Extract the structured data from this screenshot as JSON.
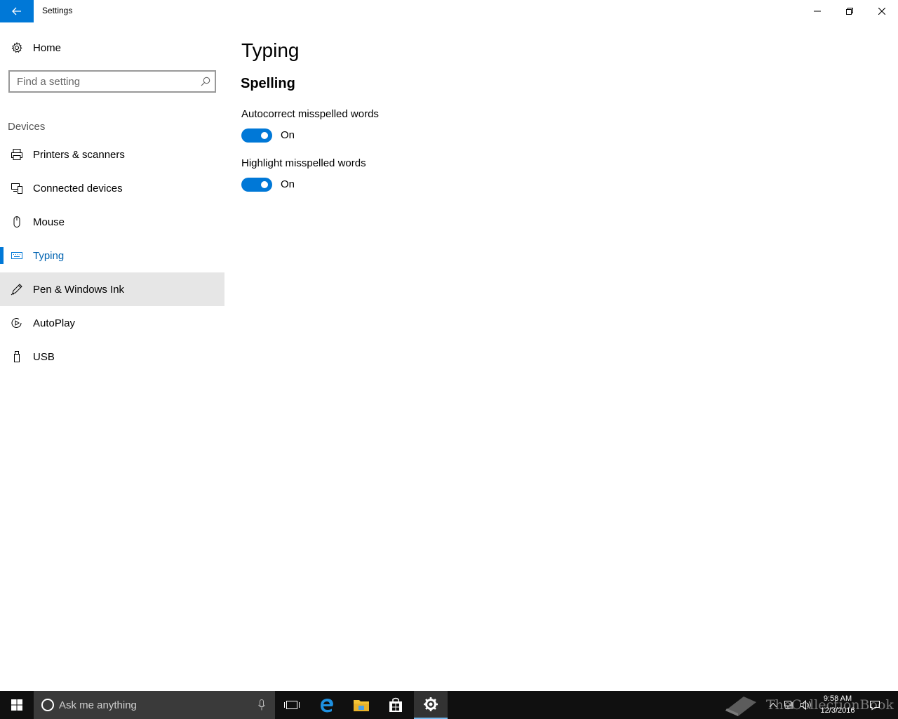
{
  "window": {
    "title": "Settings"
  },
  "sidebar": {
    "home_label": "Home",
    "search_placeholder": "Find a setting",
    "section": "Devices",
    "items": [
      {
        "label": "Printers & scanners",
        "icon": "printer-icon"
      },
      {
        "label": "Connected devices",
        "icon": "connected-devices-icon"
      },
      {
        "label": "Mouse",
        "icon": "mouse-icon"
      },
      {
        "label": "Typing",
        "icon": "keyboard-icon",
        "selected": true
      },
      {
        "label": "Pen & Windows Ink",
        "icon": "pen-icon",
        "hovered": true
      },
      {
        "label": "AutoPlay",
        "icon": "autoplay-icon"
      },
      {
        "label": "USB",
        "icon": "usb-icon"
      }
    ]
  },
  "main": {
    "title": "Typing",
    "section": "Spelling",
    "settings": [
      {
        "label": "Autocorrect misspelled words",
        "state": "On",
        "enabled": true
      },
      {
        "label": "Highlight misspelled words",
        "state": "On",
        "enabled": true
      }
    ]
  },
  "taskbar": {
    "search_placeholder": "Ask me anything",
    "time": "9:58 AM",
    "date": "12/3/2016",
    "watermark": "TheCollectionBook",
    "apps": [
      "task-view-icon",
      "edge-icon",
      "file-explorer-icon",
      "store-icon",
      "settings-icon"
    ]
  },
  "colors": {
    "accent": "#0078d7",
    "selected_text": "#0063b1",
    "hover_bg": "#e6e6e6",
    "taskbar_bg": "#101010"
  }
}
